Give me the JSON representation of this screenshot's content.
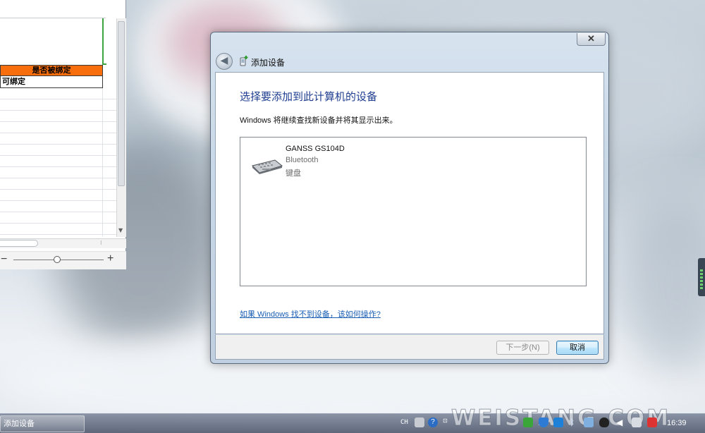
{
  "excel": {
    "header_cell": "是否被绑定",
    "value_cell": "可绑定",
    "zoom_minus": "−",
    "zoom_plus": "+"
  },
  "dialog": {
    "title": "添加设备",
    "close_label": "✕",
    "back_label": "◀",
    "heading": "选择要添加到此计算机的设备",
    "subtext": "Windows 将继续查找新设备并将其显示出来。",
    "devices": [
      {
        "name": "GANSS GS104D",
        "type": "Bluetooth",
        "category": "键盘",
        "icon": "keyboard-icon"
      }
    ],
    "help_link": "如果 Windows 找不到设备，该如何操作?",
    "next_button": "下一步(N)",
    "cancel_button": "取消"
  },
  "taskbar": {
    "task_button": "添加设备",
    "language": "CH",
    "clock": "16:39",
    "tray_icons": [
      "keyboard-tray-icon",
      "help-icon",
      "notification-icon",
      "app-icon",
      "shield-icon",
      "network-icon",
      "bluetooth-icon",
      "display-icon",
      "qq-icon",
      "volume-icon",
      "monitor-icon",
      "network-disconnected-icon"
    ]
  },
  "watermark": "WEISTANG.COM",
  "colors": {
    "excel_header_fill": "#f86e0c",
    "heading_blue": "#1e3d8f",
    "link_blue": "#1a5fb4"
  }
}
